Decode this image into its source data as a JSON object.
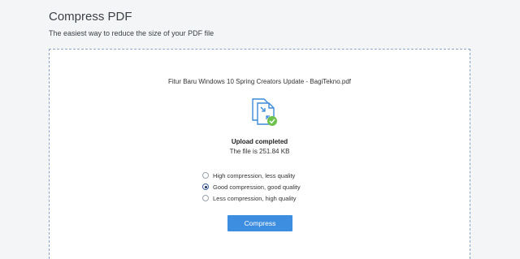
{
  "header": {
    "title": "Compress PDF",
    "subtitle": "The easiest way to reduce the size of your PDF file"
  },
  "upload": {
    "filename": "Fitur Baru Windows 10 Spring Creators Update - BagiTekno.pdf",
    "status": "Upload completed",
    "size_text": "The file is 251.84 KB",
    "icon": "pdf-compress-icon",
    "check_icon": "check-badge-icon"
  },
  "options": [
    {
      "label": "High compression, less quality",
      "selected": false
    },
    {
      "label": "Good compression, good quality",
      "selected": true
    },
    {
      "label": "Less compression, high quality",
      "selected": false
    }
  ],
  "actions": {
    "compress_label": "Compress"
  },
  "colors": {
    "accent": "#3d8ee0",
    "icon_blue": "#3b8ad8",
    "check_green": "#6cc24a",
    "border_dashed": "#8aa3c8"
  }
}
